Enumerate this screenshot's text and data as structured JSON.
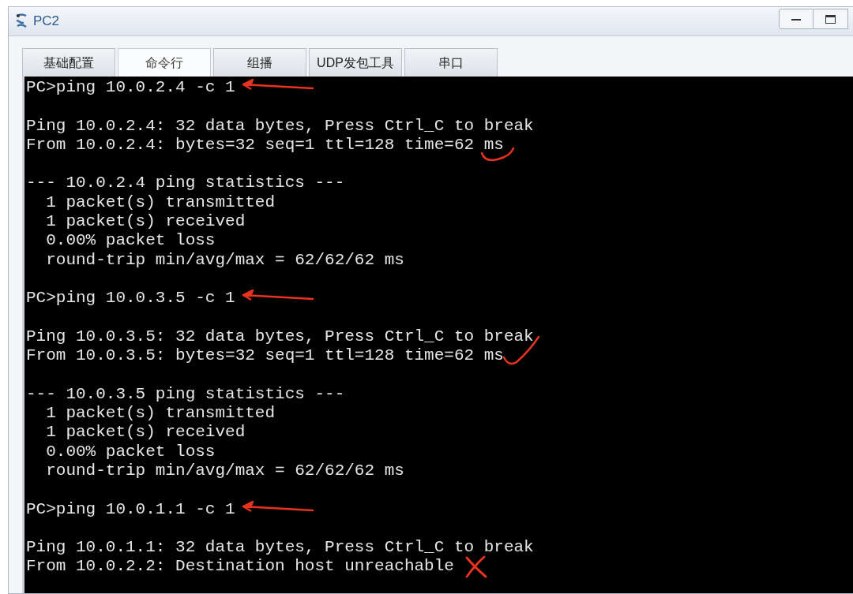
{
  "window": {
    "title": "PC2"
  },
  "tabs": [
    {
      "label": "基础配置",
      "selected": false
    },
    {
      "label": "命令行",
      "selected": true
    },
    {
      "label": "组播",
      "selected": false
    },
    {
      "label": "UDP发包工具",
      "selected": false
    },
    {
      "label": "串口",
      "selected": false
    }
  ],
  "terminal": {
    "blocks": [
      [
        {
          "text": "PC>ping 10.0.2.4 -c 1",
          "kind": "arrow"
        }
      ],
      [
        {
          "text": "Ping 10.0.2.4: 32 data bytes, Press Ctrl_C to break",
          "kind": "plain"
        },
        {
          "text": "From 10.0.2.4: bytes=32 seq=1 ttl=128 time=62 ms",
          "kind": "check"
        }
      ],
      [
        {
          "text": "--- 10.0.2.4 ping statistics ---",
          "kind": "plain"
        },
        {
          "text": "  1 packet(s) transmitted",
          "kind": "plain"
        },
        {
          "text": "  1 packet(s) received",
          "kind": "plain"
        },
        {
          "text": "  0.00% packet loss",
          "kind": "plain"
        },
        {
          "text": "  round-trip min/avg/max = 62/62/62 ms",
          "kind": "plain"
        }
      ],
      [
        {
          "text": "PC>ping 10.0.3.5 -c 1",
          "kind": "arrow"
        }
      ],
      [
        {
          "text": "Ping 10.0.3.5: 32 data bytes, Press Ctrl_C to break",
          "kind": "plain"
        },
        {
          "text": "From 10.0.3.5: bytes=32 seq=1 ttl=128 time=62 ms",
          "kind": "tick"
        }
      ],
      [
        {
          "text": "--- 10.0.3.5 ping statistics ---",
          "kind": "plain"
        },
        {
          "text": "  1 packet(s) transmitted",
          "kind": "plain"
        },
        {
          "text": "  1 packet(s) received",
          "kind": "plain"
        },
        {
          "text": "  0.00% packet loss",
          "kind": "plain"
        },
        {
          "text": "  round-trip min/avg/max = 62/62/62 ms",
          "kind": "plain"
        }
      ],
      [
        {
          "text": "PC>ping 10.0.1.1 -c 1",
          "kind": "arrow"
        }
      ],
      [
        {
          "text": "Ping 10.0.1.1: 32 data bytes, Press Ctrl_C to break",
          "kind": "plain"
        },
        {
          "text": "From 10.0.2.2: Destination host unreachable",
          "kind": "cross"
        }
      ]
    ]
  }
}
